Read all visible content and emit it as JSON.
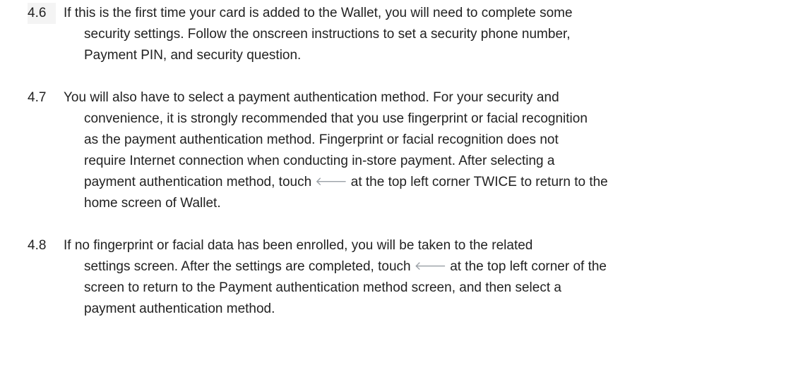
{
  "items": [
    {
      "number": "4.6",
      "lines": [
        "If this is the first time your card is added to the Wallet, you will need to complete some",
        "security settings. Follow the  onscreen  instructions  to  set  a  security  phone number,",
        "Payment PIN, and security question."
      ]
    },
    {
      "number": "4.7",
      "lines": [
        "You will also have to select a payment authentication method. For your security and",
        "convenience, it is strongly recommended that you use fingerprint or facial recognition",
        "as the payment authentication method. Fingerprint or facial recognition does not",
        "require Internet connection when conducting in-store payment. After selecting a",
        "home screen of Wallet."
      ],
      "arrow_line": {
        "before": "payment authentication method, touch",
        "after": "at the top left corner TWICE to return to the"
      }
    },
    {
      "number": "4.8",
      "lines": [
        "If no fingerprint or facial data has been enrolled, you will be taken to the related",
        "screen to return to the Payment authentication method screen, and then select a",
        "payment authentication method."
      ],
      "arrow_line": {
        "before": "settings screen. After the settings are completed, touch",
        "after": "at the top left corner of the"
      }
    }
  ],
  "icons": {
    "back_arrow": "back-arrow-icon"
  },
  "colors": {
    "text": "#222222",
    "arrow": "#9aa0a6"
  }
}
